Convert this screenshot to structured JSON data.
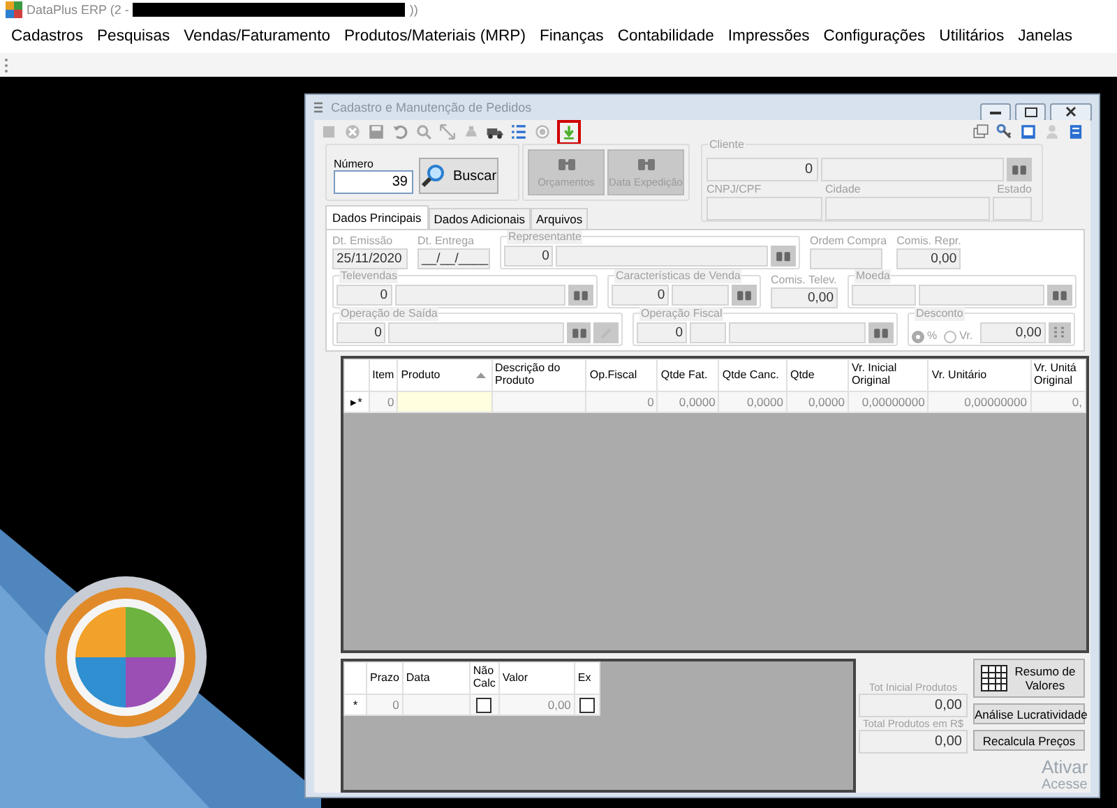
{
  "app": {
    "title": "DataPlus ERP (2 -",
    "title_suffix": "))"
  },
  "menu": [
    "Cadastros",
    "Pesquisas",
    "Vendas/Faturamento",
    "Produtos/Materiais (MRP)",
    "Finanças",
    "Contabilidade",
    "Impressões",
    "Configurações",
    "Utilitários",
    "Janelas"
  ],
  "window": {
    "title": "Cadastro e Manutenção de Pedidos"
  },
  "search": {
    "label": "Número",
    "value": "39",
    "button": "Buscar"
  },
  "action_buttons": [
    {
      "label": "Orçamentos",
      "disabled": true
    },
    {
      "label": "Data Expedição",
      "disabled": true
    }
  ],
  "cliente": {
    "label": "Cliente",
    "code": "0",
    "cnpj_label": "CNPJ/CPF",
    "cidade_label": "Cidade",
    "estado_label": "Estado"
  },
  "tabs": [
    {
      "label": "Dados Principais",
      "selected": true
    },
    {
      "label": "Dados Adicionais",
      "selected": false
    },
    {
      "label": "Arquivos",
      "selected": false
    }
  ],
  "form": {
    "disabled": true,
    "emissao": {
      "label": "Dt. Emissão",
      "value": "25/11/2020"
    },
    "entrega": {
      "label": "Dt. Entrega",
      "value": "__/__/____"
    },
    "representante": {
      "label": "Representante",
      "code": "0"
    },
    "ordem_compra": {
      "label": "Ordem Compra"
    },
    "comis_repr": {
      "label": "Comis. Repr.",
      "value": "0,00"
    },
    "televendas": {
      "label": "Televendas",
      "code": "0"
    },
    "caracteristicas": {
      "label": "Características de Venda",
      "code": "0"
    },
    "comis_telev": {
      "label": "Comis. Telev.",
      "value": "0,00"
    },
    "moeda": {
      "label": "Moeda"
    },
    "operacao_saida": {
      "label": "Operação de Saída",
      "code": "0"
    },
    "operacao_fiscal": {
      "label": "Operação Fiscal",
      "code": "0"
    },
    "desconto": {
      "label": "Desconto",
      "options": [
        {
          "label": "%",
          "selected": true
        },
        {
          "label": "Vr.",
          "selected": false
        }
      ],
      "value": "0,00"
    }
  },
  "items_grid": {
    "columns": [
      "",
      "Item",
      "Produto",
      "Descrição do Produto",
      "Op.Fiscal",
      "Qtde Fat.",
      "Qtde Canc.",
      "Qtde",
      "Vr. Inicial Original",
      "Vr. Unitário",
      "Vr. Unitá Original"
    ],
    "rows": [
      [
        "▸*",
        "0",
        "",
        "",
        "0",
        "0,0000",
        "0,0000",
        "0,0000",
        "0,00000000",
        "0,00000000",
        "0,"
      ]
    ]
  },
  "installments": {
    "columns": [
      "",
      "Prazo",
      "Data",
      "Não Calc",
      "Valor",
      "Ex"
    ],
    "rows": [
      {
        "marker": "*",
        "prazo": "0",
        "data": "",
        "nao_calc": false,
        "valor": "0,00",
        "ex": false
      }
    ]
  },
  "totals": {
    "summary_button": "Resumo de Valores",
    "tot_inicial_label": "Tot Inicial Produtos",
    "tot_inicial": "0,00",
    "total_label": "Total Produtos em R$",
    "total": "0,00",
    "analise_button": "Análise Lucratividade",
    "recalcula_button": "Recalcula Preços"
  },
  "activation": [
    "Ativar",
    "Acesse"
  ]
}
